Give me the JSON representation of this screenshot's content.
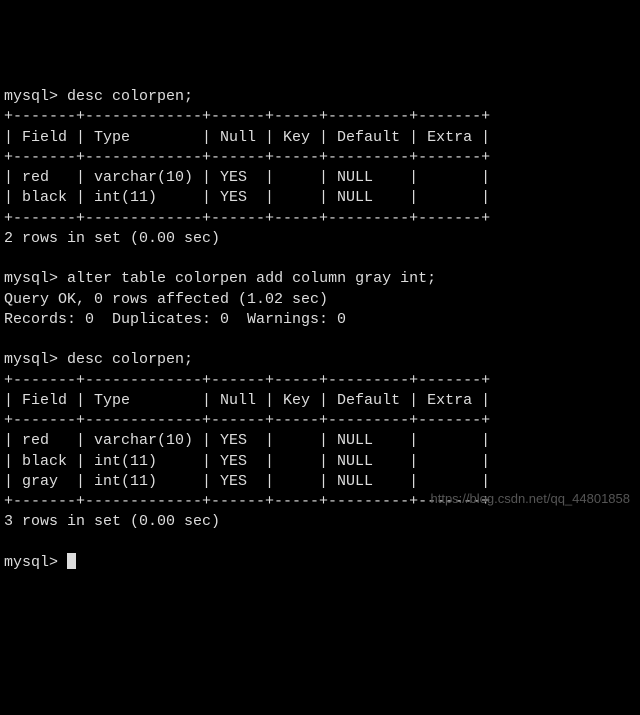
{
  "session": {
    "prompt": "mysql>",
    "cmd1": "desc colorpen;",
    "cmd2": "alter table colorpen add column gray int;",
    "cmd3": "desc colorpen;",
    "query_ok": "Query OK, 0 rows affected (1.02 sec)",
    "records": "Records: 0  Duplicates: 0  Warnings: 0",
    "rows1": "2 rows in set (0.00 sec)",
    "rows2": "3 rows in set (0.00 sec)"
  },
  "table1": {
    "sep": "+-------+-------------+------+-----+---------+-------+",
    "header": "| Field | Type        | Null | Key | Default | Extra |",
    "row1": "| red   | varchar(10) | YES  |     | NULL    |       |",
    "row2": "| black | int(11)     | YES  |     | NULL    |       |"
  },
  "table2": {
    "sep": "+-------+-------------+------+-----+---------+-------+",
    "header": "| Field | Type        | Null | Key | Default | Extra |",
    "row1": "| red   | varchar(10) | YES  |     | NULL    |       |",
    "row2": "| black | int(11)     | YES  |     | NULL    |       |",
    "row3": "| gray  | int(11)     | YES  |     | NULL    |       |"
  },
  "watermark": "https://blog.csdn.net/qq_44801858"
}
